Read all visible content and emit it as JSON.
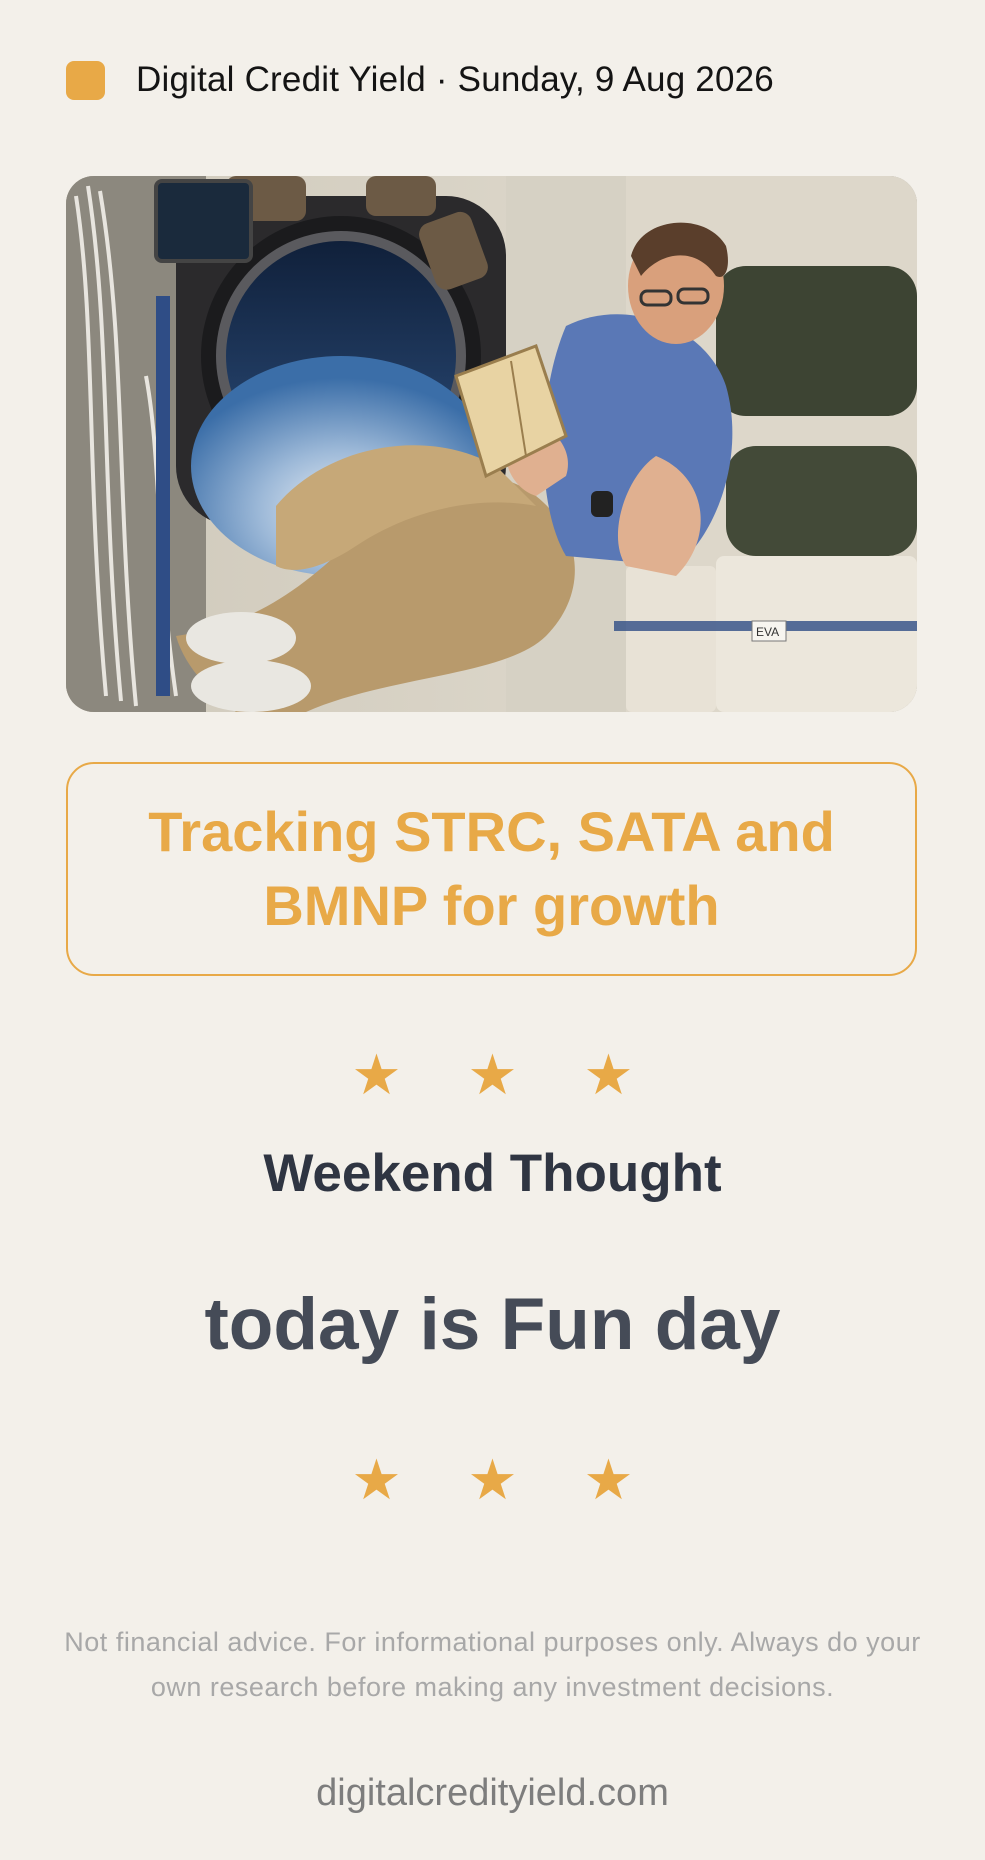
{
  "header": {
    "badge_color": "#e8a947",
    "text": "Digital Credit Yield · Sunday, 9 Aug 2026"
  },
  "photo": {
    "subject": "astronaut-reading-book-in-space-station-photo",
    "patch_label": "EVA"
  },
  "headline": {
    "text": "Tracking STRC, SATA and BMNP for growth"
  },
  "decor": {
    "stars": "★ ★ ★"
  },
  "section": {
    "label": "Weekend Thought"
  },
  "thought": {
    "text": "today is Fun day"
  },
  "footer": {
    "disclaimer": "Not financial advice. For informational purposes only. Always do your own research before making any investment decisions.",
    "site": "digitalcredityield.com"
  },
  "colors": {
    "accent": "#e8a947",
    "background": "#f3f0ea",
    "heading": "#2f3542",
    "thought": "#454b57",
    "muted": "#a8a8a8"
  }
}
